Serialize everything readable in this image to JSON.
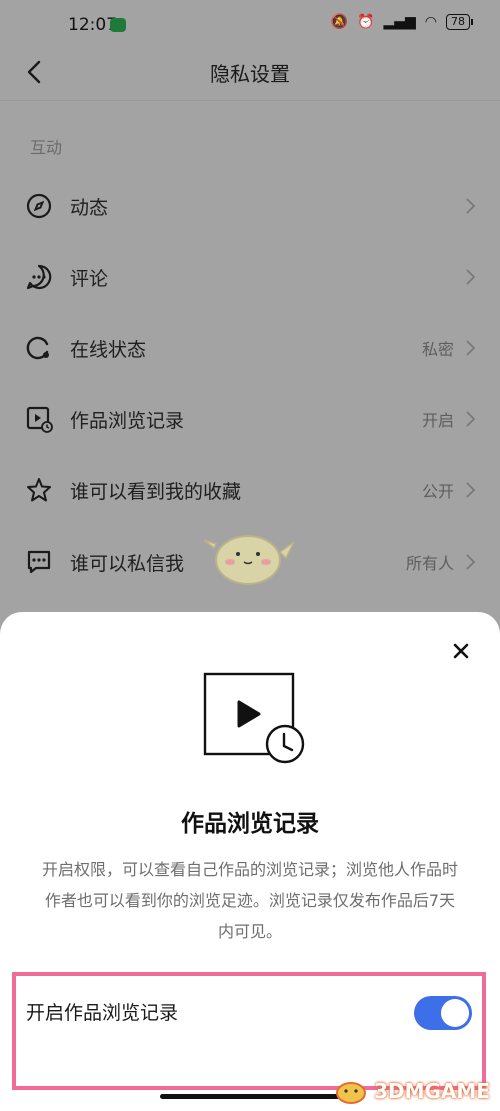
{
  "status_bar": {
    "time": "12:07",
    "battery": "78"
  },
  "header": {
    "title": "隐私设置"
  },
  "section": {
    "label": "互动"
  },
  "rows": [
    {
      "label": "动态",
      "value": ""
    },
    {
      "label": "评论",
      "value": ""
    },
    {
      "label": "在线状态",
      "value": "私密"
    },
    {
      "label": "作品浏览记录",
      "value": "开启"
    },
    {
      "label": "谁可以看到我的收藏",
      "value": "公开"
    },
    {
      "label": "谁可以私信我",
      "value": "所有人"
    }
  ],
  "sheet": {
    "title": "作品浏览记录",
    "description": "开启权限，可以查看自己作品的浏览记录；浏览他人作品时作者也可以看到你的浏览足迹。浏览记录仅发布作品后7天内可见。",
    "toggle_label": "开启作品浏览记录",
    "toggle_on": true
  },
  "watermark": {
    "text": "3DMGAME"
  },
  "colors": {
    "accent": "#3d6fe8",
    "highlight_border": "#f06a9a",
    "overlay": "#a3a3a3"
  }
}
